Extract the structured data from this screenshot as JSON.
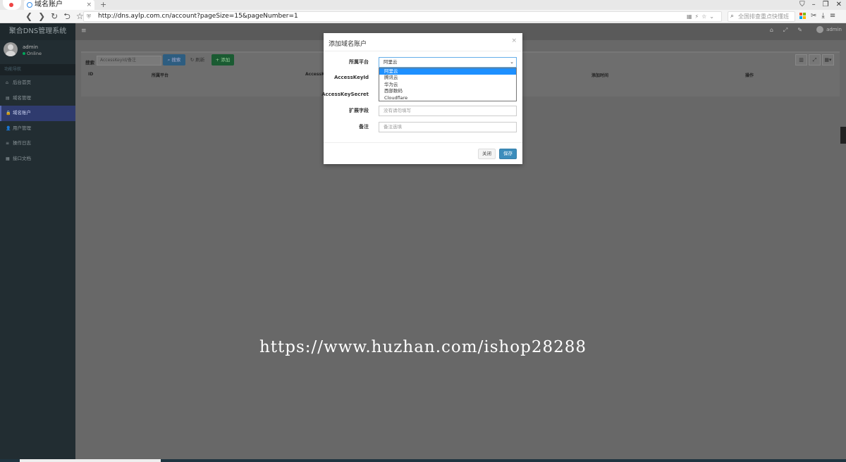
{
  "browser": {
    "tab_title": "域名账户",
    "tab_close": "×",
    "new_tab": "+",
    "url": "http://dns.aylp.com.cn/account?pageSize=15&pageNumber=1",
    "search_placeholder": "全国排查重点快懂班",
    "nav": {
      "back": "❮",
      "forward": "❯",
      "reload": "↻",
      "undo": "⮌",
      "star": "☆"
    },
    "window_controls": [
      "⛉",
      "–",
      "❐",
      "✕"
    ]
  },
  "sidebar": {
    "brand": "聚合DNS管理系统",
    "user": {
      "name": "admin",
      "status": "Online"
    },
    "nav_header": "功能导航",
    "items": [
      {
        "icon": "⌂",
        "label": "后台首页",
        "active": false
      },
      {
        "icon": "▤",
        "label": "域名管理",
        "active": false
      },
      {
        "icon": "🔒",
        "label": "域名账户",
        "active": true
      },
      {
        "icon": "👤",
        "label": "用户管理",
        "active": false
      },
      {
        "icon": "≡",
        "label": "操作日志",
        "active": false
      },
      {
        "icon": "▦",
        "label": "接口文档",
        "active": false
      }
    ]
  },
  "topbar": {
    "menu_icon": "≡",
    "icons": [
      "⌂",
      "⤢",
      "✎"
    ],
    "username": "admin"
  },
  "toolbar": {
    "search_label": "搜索",
    "search_placeholder": "AccessKeyId/备注",
    "search_button": "搜索",
    "refresh_button": "刷新",
    "add_button": "添加",
    "tool_icons": [
      "▥",
      "⤢",
      "▦▾"
    ]
  },
  "table": {
    "columns": [
      "ID",
      "所属平台",
      "AccessKeyId",
      "添加时间",
      "操作"
    ]
  },
  "modal": {
    "title": "添加域名账户",
    "close": "×",
    "fields": {
      "platform": {
        "label": "所属平台",
        "value": "阿里云"
      },
      "access_key_id": {
        "label": "AccessKeyId"
      },
      "access_key_secret": {
        "label": "AccessKeySecret"
      },
      "ext_field": {
        "label": "扩展字段",
        "placeholder": "没有请勿填写"
      },
      "remark": {
        "label": "备注",
        "placeholder": "备注选填"
      }
    },
    "dropdown_options": [
      "阿里云",
      "腾讯云",
      "华为云",
      "西部数码",
      "Cloudflare"
    ],
    "selected_option": "阿里云",
    "buttons": {
      "close": "关闭",
      "save": "保存"
    }
  },
  "watermark": "https://www.huzhan.com/ishop28288"
}
